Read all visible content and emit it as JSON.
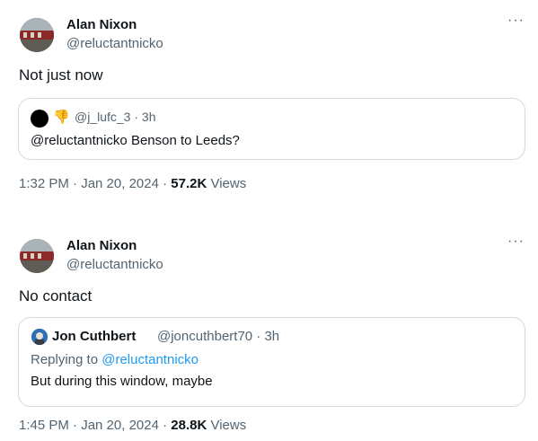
{
  "tweets": [
    {
      "author": {
        "name": "Alan Nixon",
        "handle": "@reluctantnicko"
      },
      "text": "Not just now",
      "quote": {
        "meta": "@j_lufc_3 · 3h",
        "text": "@reluctantnicko Benson to Leeds?"
      },
      "footer": {
        "time": "1:32 PM · Jan 20, 2024 · ",
        "views": "57.2K",
        "views_label": " Views"
      }
    },
    {
      "author": {
        "name": "Alan Nixon",
        "handle": "@reluctantnicko"
      },
      "text": "No contact",
      "quote": {
        "name": "Jon Cuthbert",
        "handle": "@joncuthbert70 · 3h",
        "replying_prefix": "Replying to ",
        "replying_to": "@reluctantnicko",
        "text": "But during this window, maybe"
      },
      "footer": {
        "time": "1:45 PM · Jan 20, 2024 · ",
        "views": "28.8K",
        "views_label": " Views"
      }
    }
  ],
  "more_label": "···",
  "colors": {
    "text": "#0f1419",
    "muted": "#536471",
    "link": "#1d9bf0",
    "border": "#cfd9de"
  }
}
